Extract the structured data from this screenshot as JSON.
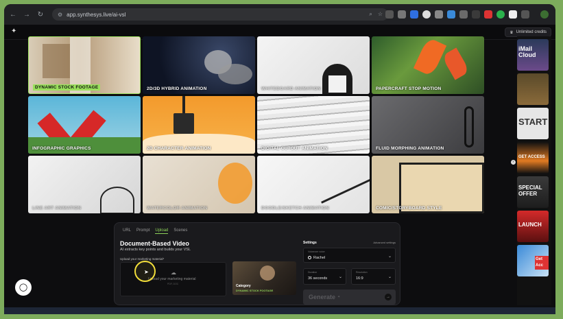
{
  "browser": {
    "url": "app.synthesys.live/ai-vsl",
    "nav": [
      "←",
      "→",
      "↻",
      "⌂"
    ]
  },
  "appbar": {
    "credits_label": "Unlimited credits"
  },
  "styles": [
    {
      "label": "DYNAMIC STOCK FOOTAGE",
      "highlight": true
    },
    {
      "label": "2D/3D HYBRID ANIMATION"
    },
    {
      "label": "WHITEBOARD ANIMATION"
    },
    {
      "label": "PAPERCRAFT STOP MOTION"
    },
    {
      "label": "INFOGRAPHIC GRAPHICS"
    },
    {
      "label": "2D CHARACTER ANIMATION"
    },
    {
      "label": "DIGITAL CUTOUT ANIMATION"
    },
    {
      "label": "FLUID MORPHING ANIMATION"
    },
    {
      "label": "LINE ART ANIMATION"
    },
    {
      "label": "WATERCOLOR ANIMATION"
    },
    {
      "label": "DOODLE/SKETCH ANIMATION"
    },
    {
      "label": "COMIC/STORYBOARD STYLE"
    }
  ],
  "rail": {
    "thumbs": [
      "iMail Cloud",
      "",
      "START",
      "GET ACCESS",
      "SPECIAL OFFER",
      "LAUNCH",
      "Get Acc"
    ]
  },
  "panel": {
    "tabs": [
      "URL",
      "Prompt",
      "Upload",
      "Scenes"
    ],
    "active_tab": "Upload",
    "title": "Document-Based Video",
    "subtitle": "AI extracts key points and builds your VSL",
    "upload_label": "Upload your marketing material*",
    "dropzone_text": "Upload your marketing material",
    "dropzone_small": "PDF, DOC",
    "category_label": "Category",
    "category_value": "DYNAMIC STOCK FOOTAGE",
    "settings_title": "Settings",
    "advanced_label": "Advanced settings",
    "voice_label": "Voiceover voice",
    "voice_value": "Rachel",
    "duration_label": "Duration",
    "duration_value": "36 seconds",
    "resolution_label": "Resolution",
    "resolution_value": "16:9",
    "generate_label": "Generate",
    "generate_icon": "✦"
  }
}
